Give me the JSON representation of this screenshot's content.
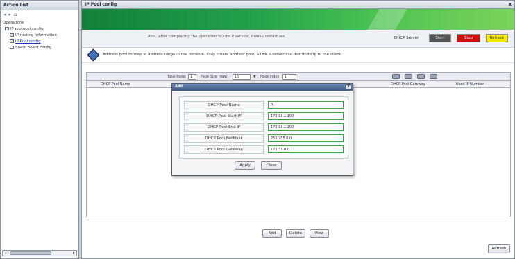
{
  "action_list": {
    "title": "Action List",
    "toolbar_icons": [
      "back-arrow-icon",
      "forward-arrow-icon",
      "home-icon"
    ],
    "tree": [
      {
        "label": "Operations",
        "level": 0
      },
      {
        "label": "IP protocol config",
        "level": 1
      },
      {
        "label": "IP routing information",
        "level": 2
      },
      {
        "label": "IP Pool config",
        "level": 2,
        "selected": true
      },
      {
        "label": "Static Board config",
        "level": 2
      }
    ]
  },
  "window": {
    "title": "IP Pool config",
    "close_glyph": "x"
  },
  "status_bar": {
    "message": "Also, after completing the operation to DHCP service, Please restart ser.",
    "dhcp_label": "DHCP Server",
    "start_label": "Start",
    "stop_label": "Stop",
    "refresh_label": "Refresh"
  },
  "info": {
    "text": "Address pool to map IP address range in the network. Only create address pool, a DHCP server can distribute ip to the client"
  },
  "pager": {
    "total_label": "Total Page:",
    "total_value": "1",
    "page_size_label": "Page Size (row):",
    "page_size_value": "15",
    "page_index_label": "Page index:",
    "page_index_value": "1"
  },
  "table": {
    "columns": [
      "DHCP Pool Name",
      "DHCP Pool Gateway",
      "Used IP Number"
    ]
  },
  "actions": {
    "add": "Add",
    "delete": "Delete",
    "view": "View",
    "refresh": "Refresh"
  },
  "dialog": {
    "title": "Add",
    "close_glyph": "x",
    "fields": [
      {
        "label": "DHCP Pool Name",
        "value": "Pl"
      },
      {
        "label": "DHCP Pool Start IP",
        "value": "172.31.1.100"
      },
      {
        "label": "DHCP Pool End IP",
        "value": "172.31.1.200"
      },
      {
        "label": "DHCP Pool NetMask",
        "value": "255.255.0.0"
      },
      {
        "label": "DHCP Pool Gateway",
        "value": "172.31.0.0"
      }
    ],
    "apply_label": "Apply",
    "close_label": "Close"
  },
  "colors": {
    "banner_green": "#23a24a",
    "stop_red": "#d01010",
    "refresh_yellow": "#f4e800",
    "input_border_green": "#3aa840"
  }
}
